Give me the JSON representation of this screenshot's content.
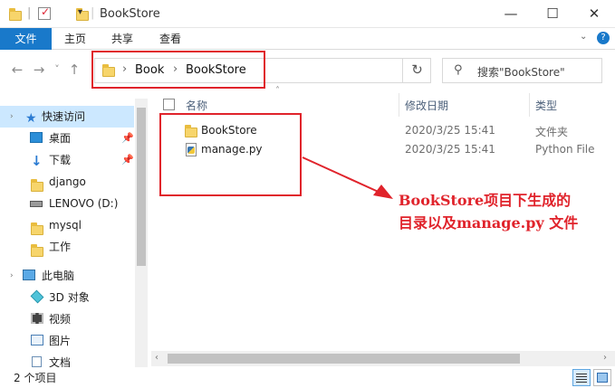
{
  "window": {
    "title": "BookStore",
    "controls": {
      "minimize": "—",
      "maximize": "☐",
      "close": "✕"
    }
  },
  "ribbon": {
    "tabs": [
      "文件",
      "主页",
      "共享",
      "查看"
    ],
    "expand_icon": "chevron-down-icon",
    "help_icon": "help-icon",
    "help_label": "?"
  },
  "nav": {
    "back_glyph": "←",
    "forward_glyph": "→",
    "recent_glyph": "˅",
    "up_glyph": "↑"
  },
  "address": {
    "path": [
      "Book",
      "BookStore"
    ],
    "separator": "›",
    "refresh_glyph": "↻"
  },
  "search": {
    "icon_glyph": "⚲",
    "placeholder": "搜索\"BookStore\""
  },
  "sidebar": {
    "items": [
      {
        "label": "快速访问",
        "icon": "star-icon",
        "pinned": false,
        "selected": true,
        "level": 0
      },
      {
        "label": "桌面",
        "icon": "desktop-icon",
        "pinned": true,
        "selected": false,
        "level": 1
      },
      {
        "label": "下载",
        "icon": "download-icon",
        "pinned": true,
        "selected": false,
        "level": 1
      },
      {
        "label": "django",
        "icon": "folder-icon",
        "pinned": false,
        "selected": false,
        "level": 1
      },
      {
        "label": "LENOVO (D:)",
        "icon": "drive-icon",
        "pinned": false,
        "selected": false,
        "level": 1
      },
      {
        "label": "mysql",
        "icon": "folder-icon",
        "pinned": false,
        "selected": false,
        "level": 1
      },
      {
        "label": "工作",
        "icon": "folder-icon",
        "pinned": false,
        "selected": false,
        "level": 1
      },
      {
        "label": "此电脑",
        "icon": "computer-icon",
        "pinned": false,
        "selected": false,
        "level": 0
      },
      {
        "label": "3D 对象",
        "icon": "3d-objects-icon",
        "pinned": false,
        "selected": false,
        "level": 1
      },
      {
        "label": "视频",
        "icon": "video-icon",
        "pinned": false,
        "selected": false,
        "level": 1
      },
      {
        "label": "图片",
        "icon": "pictures-icon",
        "pinned": false,
        "selected": false,
        "level": 1
      },
      {
        "label": "文档",
        "icon": "documents-icon",
        "pinned": false,
        "selected": false,
        "level": 1
      }
    ]
  },
  "file_list": {
    "columns": [
      "名称",
      "修改日期",
      "类型"
    ],
    "rows": [
      {
        "name": "BookStore",
        "icon": "folder-icon",
        "modified": "2020/3/25 15:41",
        "type": "文件夹"
      },
      {
        "name": "manage.py",
        "icon": "python-file-icon",
        "modified": "2020/3/25 15:41",
        "type": "Python File"
      }
    ]
  },
  "annotation": {
    "line1": "BookStore项目下生成的",
    "line2": "目录以及manage.py 文件",
    "color": "#e0232b"
  },
  "status": {
    "item_count": "2 个项目"
  },
  "colors": {
    "accent": "#1979ca",
    "selection": "#cce8ff",
    "highlight_red": "#e0232b",
    "folder_yellow": "#f7d56b"
  }
}
